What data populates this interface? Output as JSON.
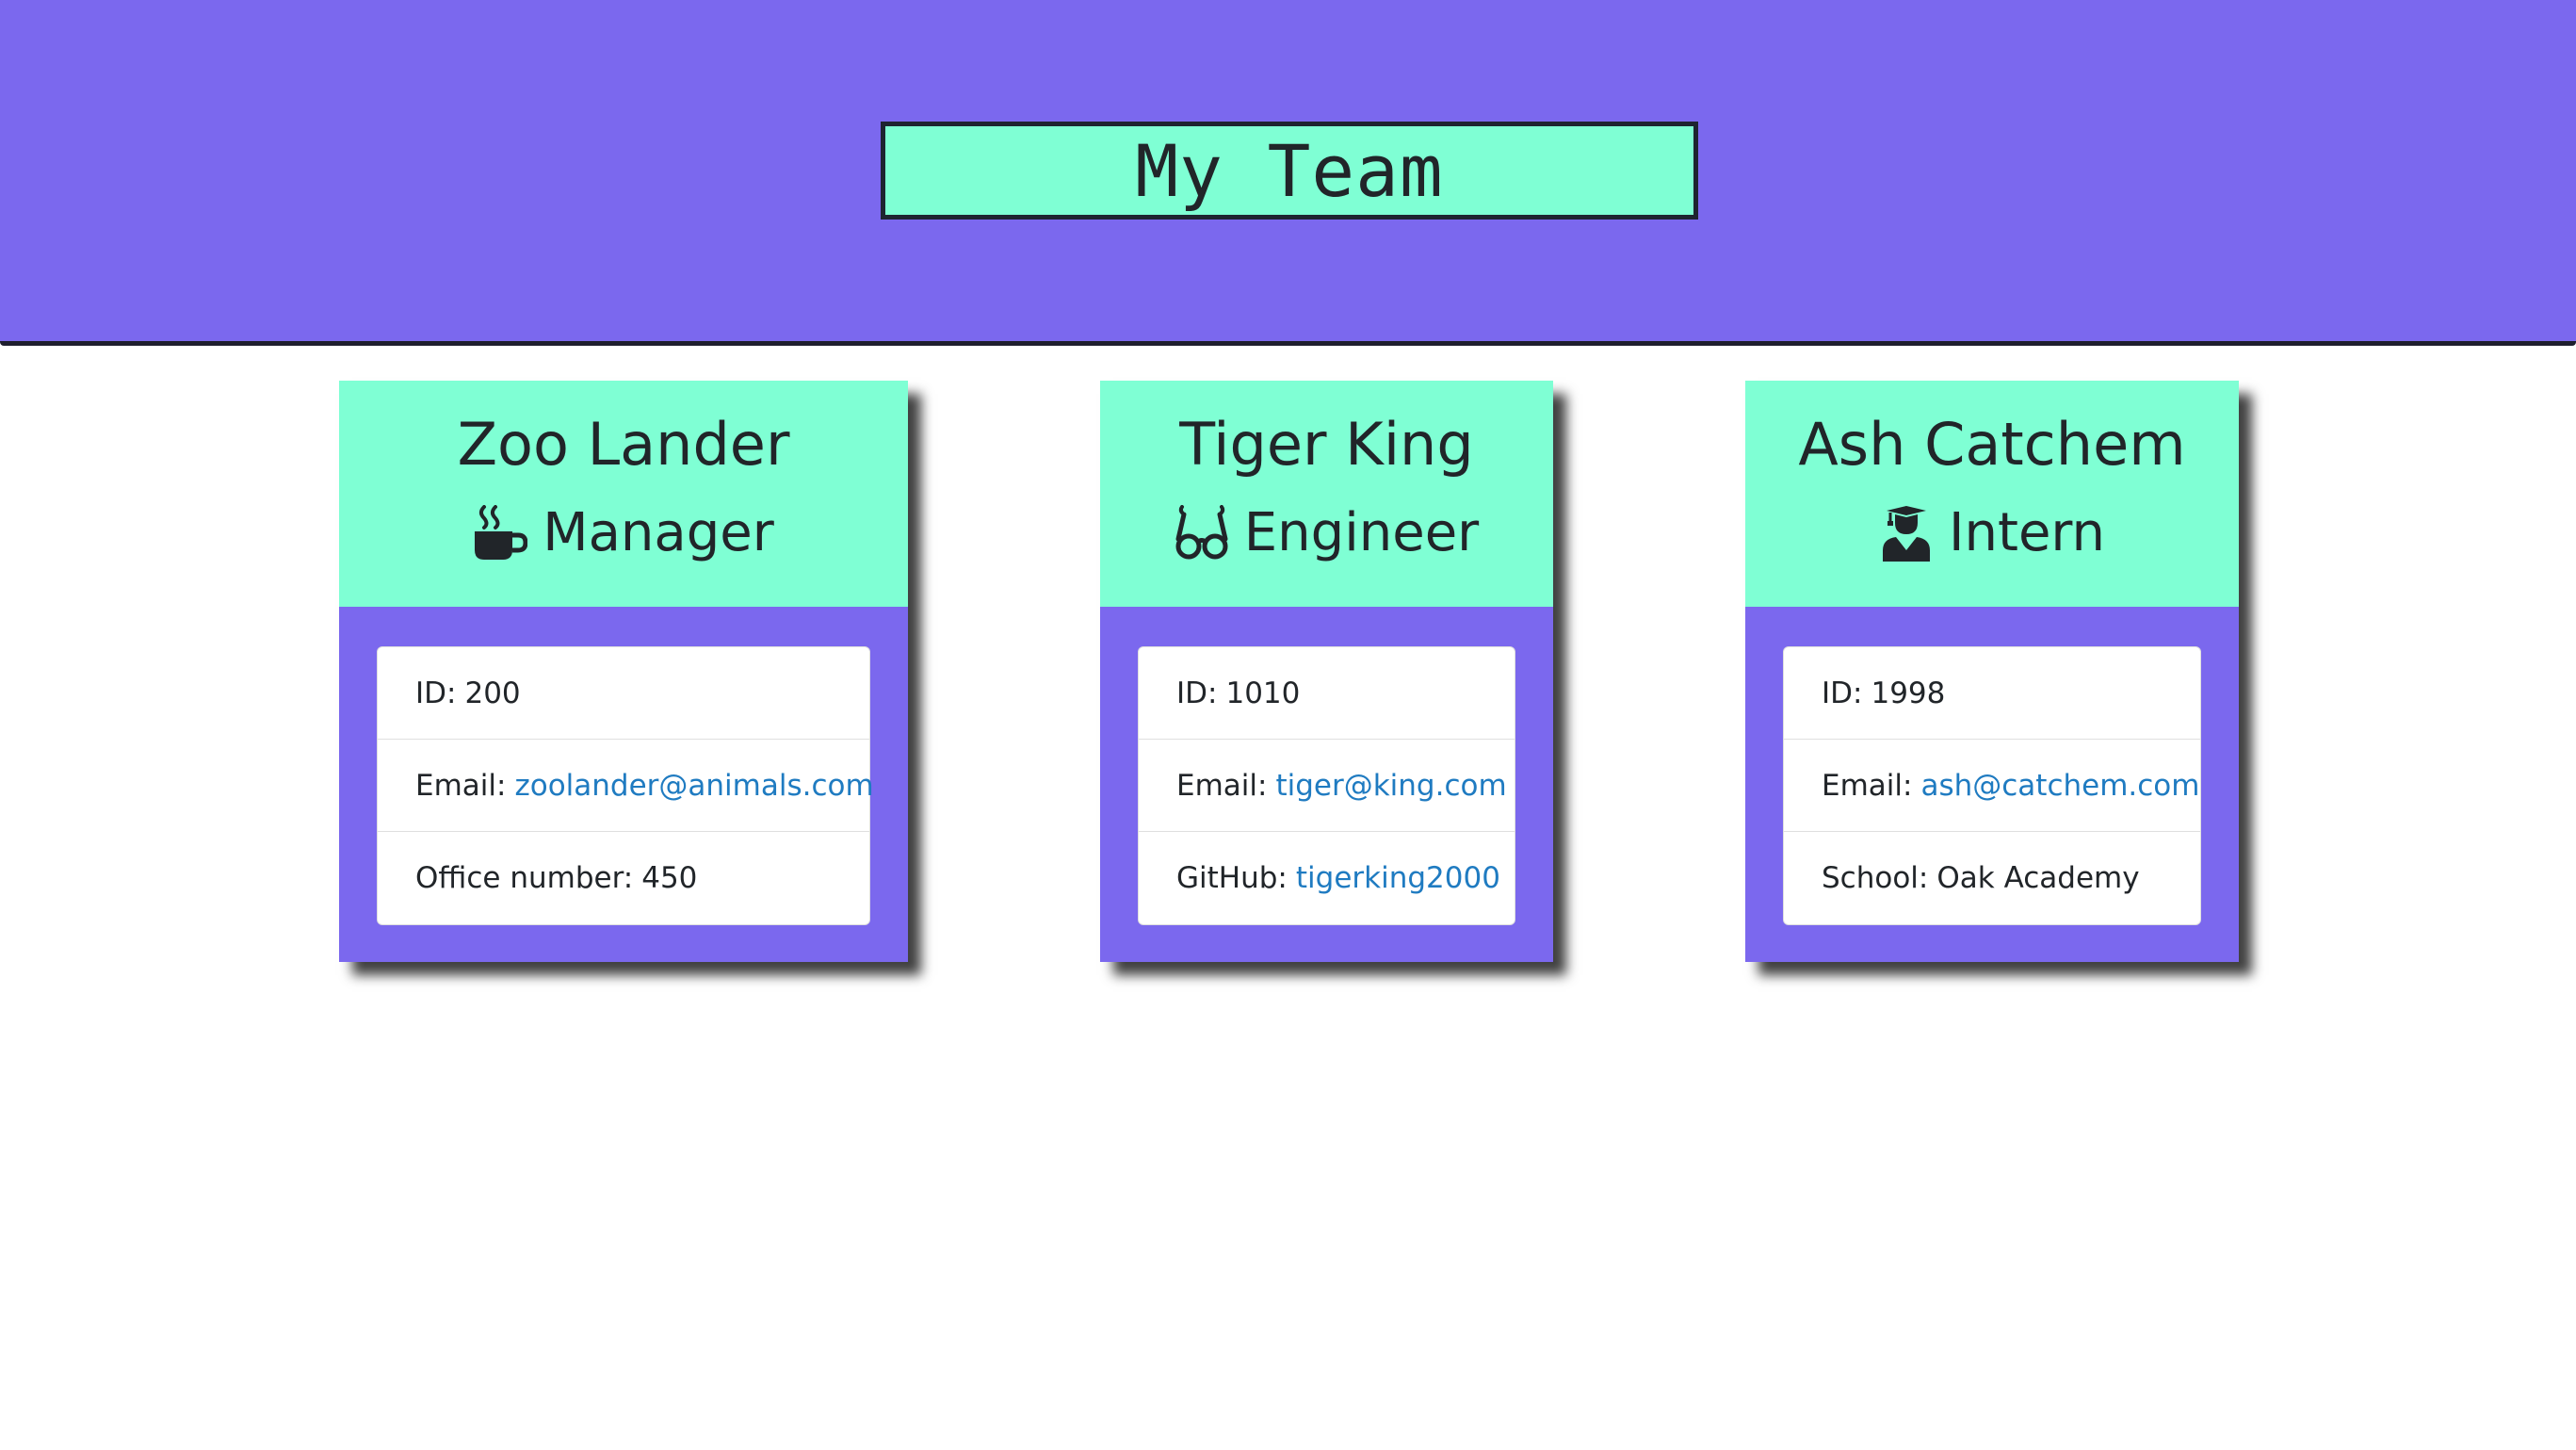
{
  "header": {
    "title": "My Team"
  },
  "members": [
    {
      "name": "Zoo Lander",
      "role": "Manager",
      "role_icon": "coffee-mug-icon",
      "id_label": "ID:",
      "id": "200",
      "email_label": "Email:",
      "email": "zoolander@animals.com",
      "extra_label": "Office number:",
      "extra_value": "450"
    },
    {
      "name": "Tiger King",
      "role": "Engineer",
      "role_icon": "glasses-icon",
      "id_label": "ID:",
      "id": "1010",
      "email_label": "Email:",
      "email": "tiger@king.com",
      "extra_label": "GitHub:",
      "extra_value": "tigerking2000"
    },
    {
      "name": "Ash Catchem",
      "role": "Intern",
      "role_icon": "graduate-icon",
      "id_label": "ID:",
      "id": "1998",
      "email_label": "Email:",
      "email": "ash@catchem.com",
      "extra_label": "School:",
      "extra_value": "Oak Academy"
    }
  ],
  "colors": {
    "header_bg": "#7b68ee",
    "accent": "#7fffd4",
    "link": "#1f7bc1"
  }
}
